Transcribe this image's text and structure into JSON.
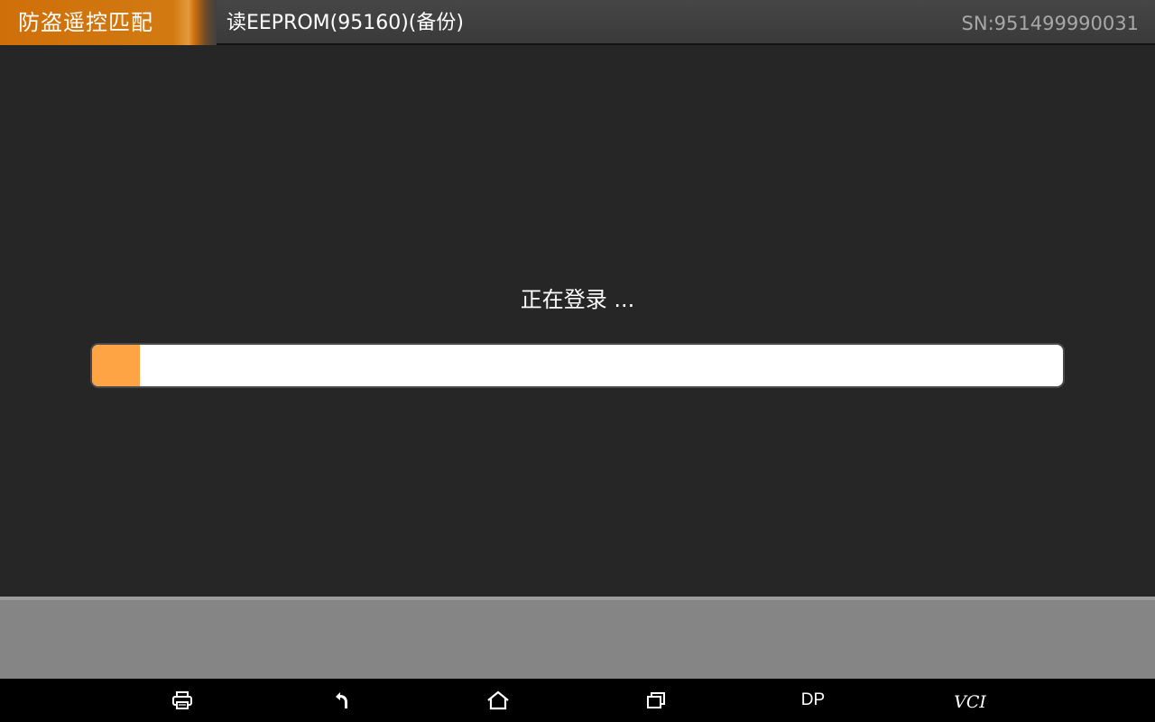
{
  "header": {
    "app_name": "防盗遥控匹配",
    "title": "读EEPROM(95160)(备份)",
    "serial": "SN:951499990031"
  },
  "main": {
    "status_text": "正在登录 ...",
    "progress_percent": 4.9,
    "progress_color": "#ffa444"
  },
  "nav_bar": {
    "buttons": [
      {
        "name": "print",
        "icon": "print-icon"
      },
      {
        "name": "back",
        "icon": "back-arrow-icon"
      },
      {
        "name": "home",
        "icon": "home-icon"
      },
      {
        "name": "recent",
        "icon": "recent-apps-icon"
      },
      {
        "name": "dp",
        "label": "DP"
      },
      {
        "name": "vci",
        "label": "VCI"
      }
    ]
  },
  "colors": {
    "accent": "#d27a12",
    "background": "#262626",
    "action_bar": "#858585"
  }
}
